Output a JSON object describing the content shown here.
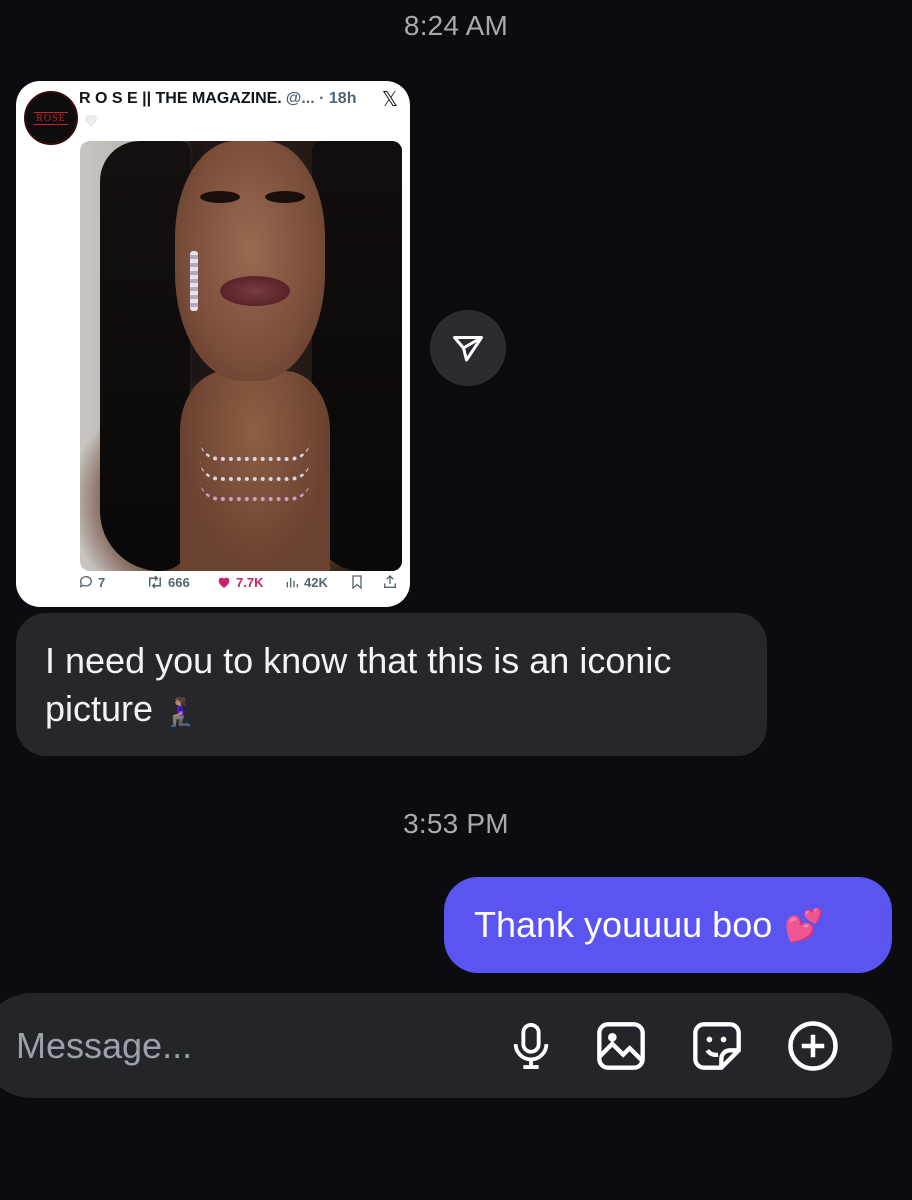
{
  "timestamps": {
    "first": "8:24 AM",
    "second": "3:53 PM"
  },
  "shared_post": {
    "account_name": "R O S E || THE MAGAZINE.",
    "handle_time": "@... · 18h",
    "platform_icon": "x-logo-icon",
    "avatar_text": "ROSE",
    "actions": {
      "replies": "7",
      "reposts": "666",
      "likes": "7.7K",
      "views": "42K"
    },
    "colors": {
      "like": "#c72470",
      "meta": "#536471"
    }
  },
  "messages": {
    "received_text": "I need you to know that this is an iconic picture",
    "received_emoji": "🧎🏽‍♀️",
    "sent_text": "Thank youuuu boo",
    "sent_emoji": "💕"
  },
  "composer": {
    "placeholder": "Message...",
    "icons": [
      "microphone-icon",
      "gallery-icon",
      "sticker-icon",
      "plus-icon"
    ]
  },
  "colors": {
    "background": "#0c0c10",
    "received_bubble": "#26272c",
    "sent_bubble": "#5a55f0",
    "composer": "#24252a"
  }
}
